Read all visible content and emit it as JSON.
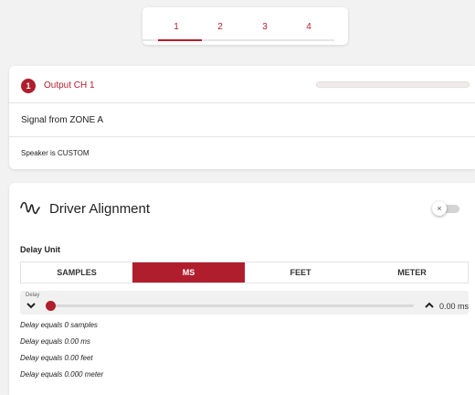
{
  "tabs": [
    {
      "label": "1",
      "active": true
    },
    {
      "label": "2",
      "active": false
    },
    {
      "label": "3",
      "active": false
    },
    {
      "label": "4",
      "active": false
    }
  ],
  "output": {
    "badge": "1",
    "title": "Output CH 1",
    "level": 0,
    "signal": "Signal from ZONE A",
    "speaker": "Speaker is CUSTOM"
  },
  "driver": {
    "title": "Driver Alignment",
    "toggle_on": false,
    "toggle_glyph": "×",
    "delay_unit_label": "Delay Unit",
    "units": [
      "SAMPLES",
      "MS",
      "FEET",
      "METER"
    ],
    "active_unit": "MS",
    "slider": {
      "caption": "Delay",
      "value": 0,
      "value_text": "0.00 ms"
    },
    "equivalents": [
      "Delay equals 0 samples",
      "Delay equals 0.00 ms",
      "Delay equals 0.00 feet",
      "Delay equals 0.000 meter"
    ]
  },
  "colors": {
    "accent": "#b01e2e",
    "background": "#f2f2f2",
    "card": "#ffffff"
  }
}
